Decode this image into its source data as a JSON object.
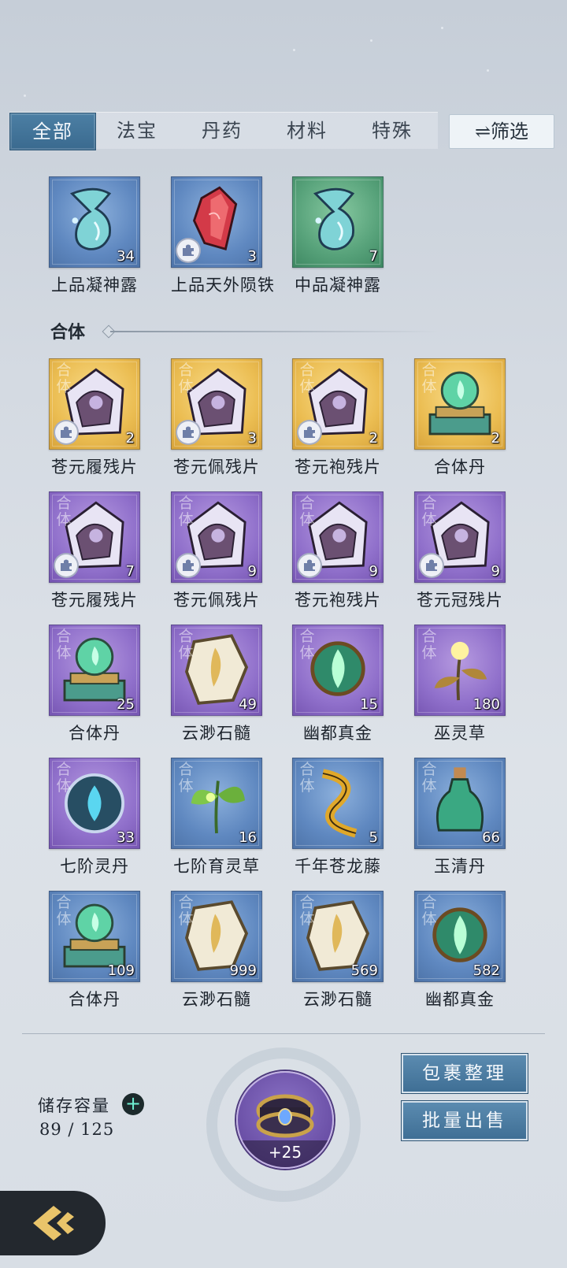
{
  "tabs": [
    {
      "label": "全部",
      "active": true
    },
    {
      "label": "法宝",
      "active": false
    },
    {
      "label": "丹药",
      "active": false
    },
    {
      "label": "材料",
      "active": false
    },
    {
      "label": "特殊",
      "active": false
    }
  ],
  "filter_label": "⇌筛选",
  "top_items": [
    {
      "name": "上品凝神露",
      "count": "34",
      "rarity": "blue",
      "icon": "potion-vase-icon",
      "badge": false
    },
    {
      "name": "上品天外陨铁",
      "count": "3",
      "rarity": "blue",
      "icon": "red-crystal-icon",
      "badge": true
    },
    {
      "name": "中品凝神露",
      "count": "7",
      "rarity": "green",
      "icon": "potion-vase-icon",
      "badge": false
    }
  ],
  "section_title": "合体",
  "section_items": [
    {
      "name": "苍元履残片",
      "count": "2",
      "rarity": "gold",
      "icon": "shard-icon",
      "tag": "合体",
      "badge": true
    },
    {
      "name": "苍元佩残片",
      "count": "3",
      "rarity": "gold",
      "icon": "shard-icon",
      "tag": "合体",
      "badge": true
    },
    {
      "name": "苍元袍残片",
      "count": "2",
      "rarity": "gold",
      "icon": "shard-icon",
      "tag": "合体",
      "badge": true
    },
    {
      "name": "合体丹",
      "count": "2",
      "rarity": "gold",
      "icon": "flame-orb-pedestal-icon",
      "tag": "合体",
      "badge": false
    },
    {
      "name": "苍元履残片",
      "count": "7",
      "rarity": "purple",
      "icon": "shard-icon",
      "tag": "合体",
      "badge": true
    },
    {
      "name": "苍元佩残片",
      "count": "9",
      "rarity": "purple",
      "icon": "shard-icon",
      "tag": "合体",
      "badge": true
    },
    {
      "name": "苍元袍残片",
      "count": "9",
      "rarity": "purple",
      "icon": "shard-icon",
      "tag": "合体",
      "badge": true
    },
    {
      "name": "苍元冠残片",
      "count": "9",
      "rarity": "purple",
      "icon": "shard-icon",
      "tag": "合体",
      "badge": true
    },
    {
      "name": "合体丹",
      "count": "25",
      "rarity": "purple",
      "icon": "flame-orb-pedestal-icon",
      "tag": "合体",
      "badge": false
    },
    {
      "name": "云渺石髓",
      "count": "49",
      "rarity": "purple",
      "icon": "white-stone-icon",
      "tag": "合体",
      "badge": false
    },
    {
      "name": "幽都真金",
      "count": "15",
      "rarity": "purple",
      "icon": "green-flame-orb-icon",
      "tag": "合体",
      "badge": false
    },
    {
      "name": "巫灵草",
      "count": "180",
      "rarity": "purple",
      "icon": "spirit-herb-icon",
      "tag": "合体",
      "badge": false
    },
    {
      "name": "七阶灵丹",
      "count": "33",
      "rarity": "purple",
      "icon": "blue-flame-orb-icon",
      "tag": "合体",
      "badge": false
    },
    {
      "name": "七阶育灵草",
      "count": "16",
      "rarity": "blue",
      "icon": "green-herb-icon",
      "tag": "合体",
      "badge": false
    },
    {
      "name": "千年苍龙藤",
      "count": "5",
      "rarity": "blue",
      "icon": "golden-vine-icon",
      "tag": "合体",
      "badge": false
    },
    {
      "name": "玉清丹",
      "count": "66",
      "rarity": "blue",
      "icon": "green-bottle-icon",
      "tag": "合体",
      "badge": false
    },
    {
      "name": "合体丹",
      "count": "109",
      "rarity": "blue",
      "icon": "flame-orb-pedestal-icon",
      "tag": "合体",
      "badge": false
    },
    {
      "name": "云渺石髓",
      "count": "999",
      "rarity": "blue",
      "icon": "white-stone-icon",
      "tag": "合体",
      "badge": false
    },
    {
      "name": "云渺石髓",
      "count": "569",
      "rarity": "blue",
      "icon": "white-stone-icon",
      "tag": "合体",
      "badge": false
    },
    {
      "name": "幽都真金",
      "count": "582",
      "rarity": "blue",
      "icon": "green-flame-orb-icon",
      "tag": "合体",
      "badge": false
    }
  ],
  "storage": {
    "label": "储存容量",
    "value": "89 / 125"
  },
  "bag": {
    "count": "+25",
    "icon": "storage-ring-icon"
  },
  "buttons": {
    "organize": "包裹整理",
    "bulk_sell": "批量出售"
  },
  "colors": {
    "blue": "#5f88c0",
    "green": "#57a27a",
    "gold": "#ebbd52",
    "purple": "#9070cb",
    "tab_active": "#3a6a8f"
  }
}
